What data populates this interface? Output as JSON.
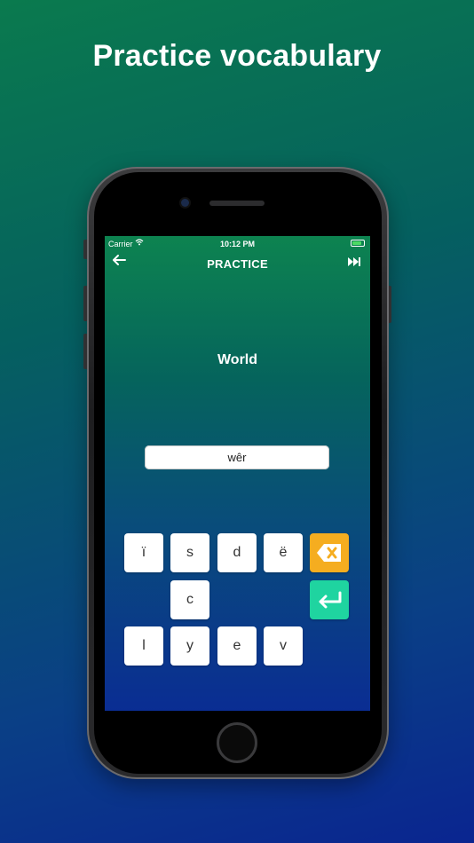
{
  "headline": "Practice vocabulary",
  "status_bar": {
    "carrier": "Carrier",
    "time": "10:12 PM"
  },
  "nav": {
    "title": "PRACTICE"
  },
  "word": "World",
  "answer_value": "wêr",
  "keyboard": {
    "row1": [
      "ï",
      "s",
      "d",
      "ë"
    ],
    "row2": [
      "c"
    ],
    "row3": [
      "l",
      "y",
      "e",
      "v"
    ]
  },
  "colors": {
    "delete_key": "#f5ad20",
    "enter_key": "#1fd4a0"
  },
  "icons": {
    "back": "arrow-left-icon",
    "skip": "fast-forward-icon",
    "delete": "backspace-icon",
    "enter": "return-icon"
  }
}
